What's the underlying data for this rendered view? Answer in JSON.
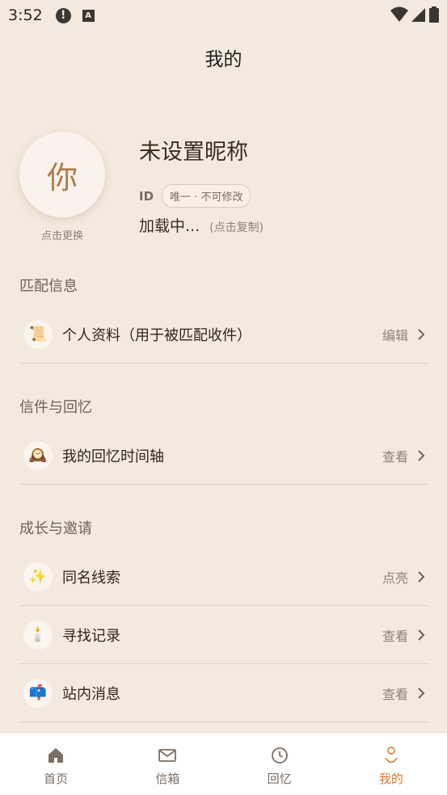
{
  "status_bar": {
    "time": "3:52",
    "alert_icon": "alert-circle-icon",
    "notify_icon": "a-badge-icon"
  },
  "header": {
    "title": "我的"
  },
  "profile": {
    "avatar_text": "你",
    "avatar_hint": "点击更换",
    "nickname": "未设置昵称",
    "id_label": "ID",
    "id_badge": "唯一 · 不可修改",
    "id_value": "加载中...",
    "copy_hint": "(点击复制)"
  },
  "sections": [
    {
      "title": "匹配信息",
      "items": [
        {
          "icon": "scroll-icon",
          "emoji": "📜",
          "label": "个人资料（用于被匹配收件）",
          "action": "编辑"
        }
      ]
    },
    {
      "title": "信件与回忆",
      "items": [
        {
          "icon": "clock-icon",
          "emoji": "🕰️",
          "label": "我的回忆时间轴",
          "action": "查看"
        }
      ]
    },
    {
      "title": "成长与邀请",
      "items": [
        {
          "icon": "sparkles-icon",
          "emoji": "✨",
          "label": "同名线索",
          "action": "点亮"
        },
        {
          "icon": "candle-icon",
          "emoji": "🕯️",
          "label": "寻找记录",
          "action": "查看"
        },
        {
          "icon": "mailbox-icon",
          "emoji": "📫",
          "label": "站内消息",
          "action": "查看"
        }
      ]
    }
  ],
  "bottom_nav": {
    "items": [
      {
        "label": "首页",
        "icon": "home-icon"
      },
      {
        "label": "信箱",
        "icon": "mail-icon"
      },
      {
        "label": "回忆",
        "icon": "clock-icon"
      },
      {
        "label": "我的",
        "icon": "profile-icon",
        "active": true
      }
    ]
  },
  "colors": {
    "background": "#f4e9df",
    "accent": "#d97a2a"
  }
}
